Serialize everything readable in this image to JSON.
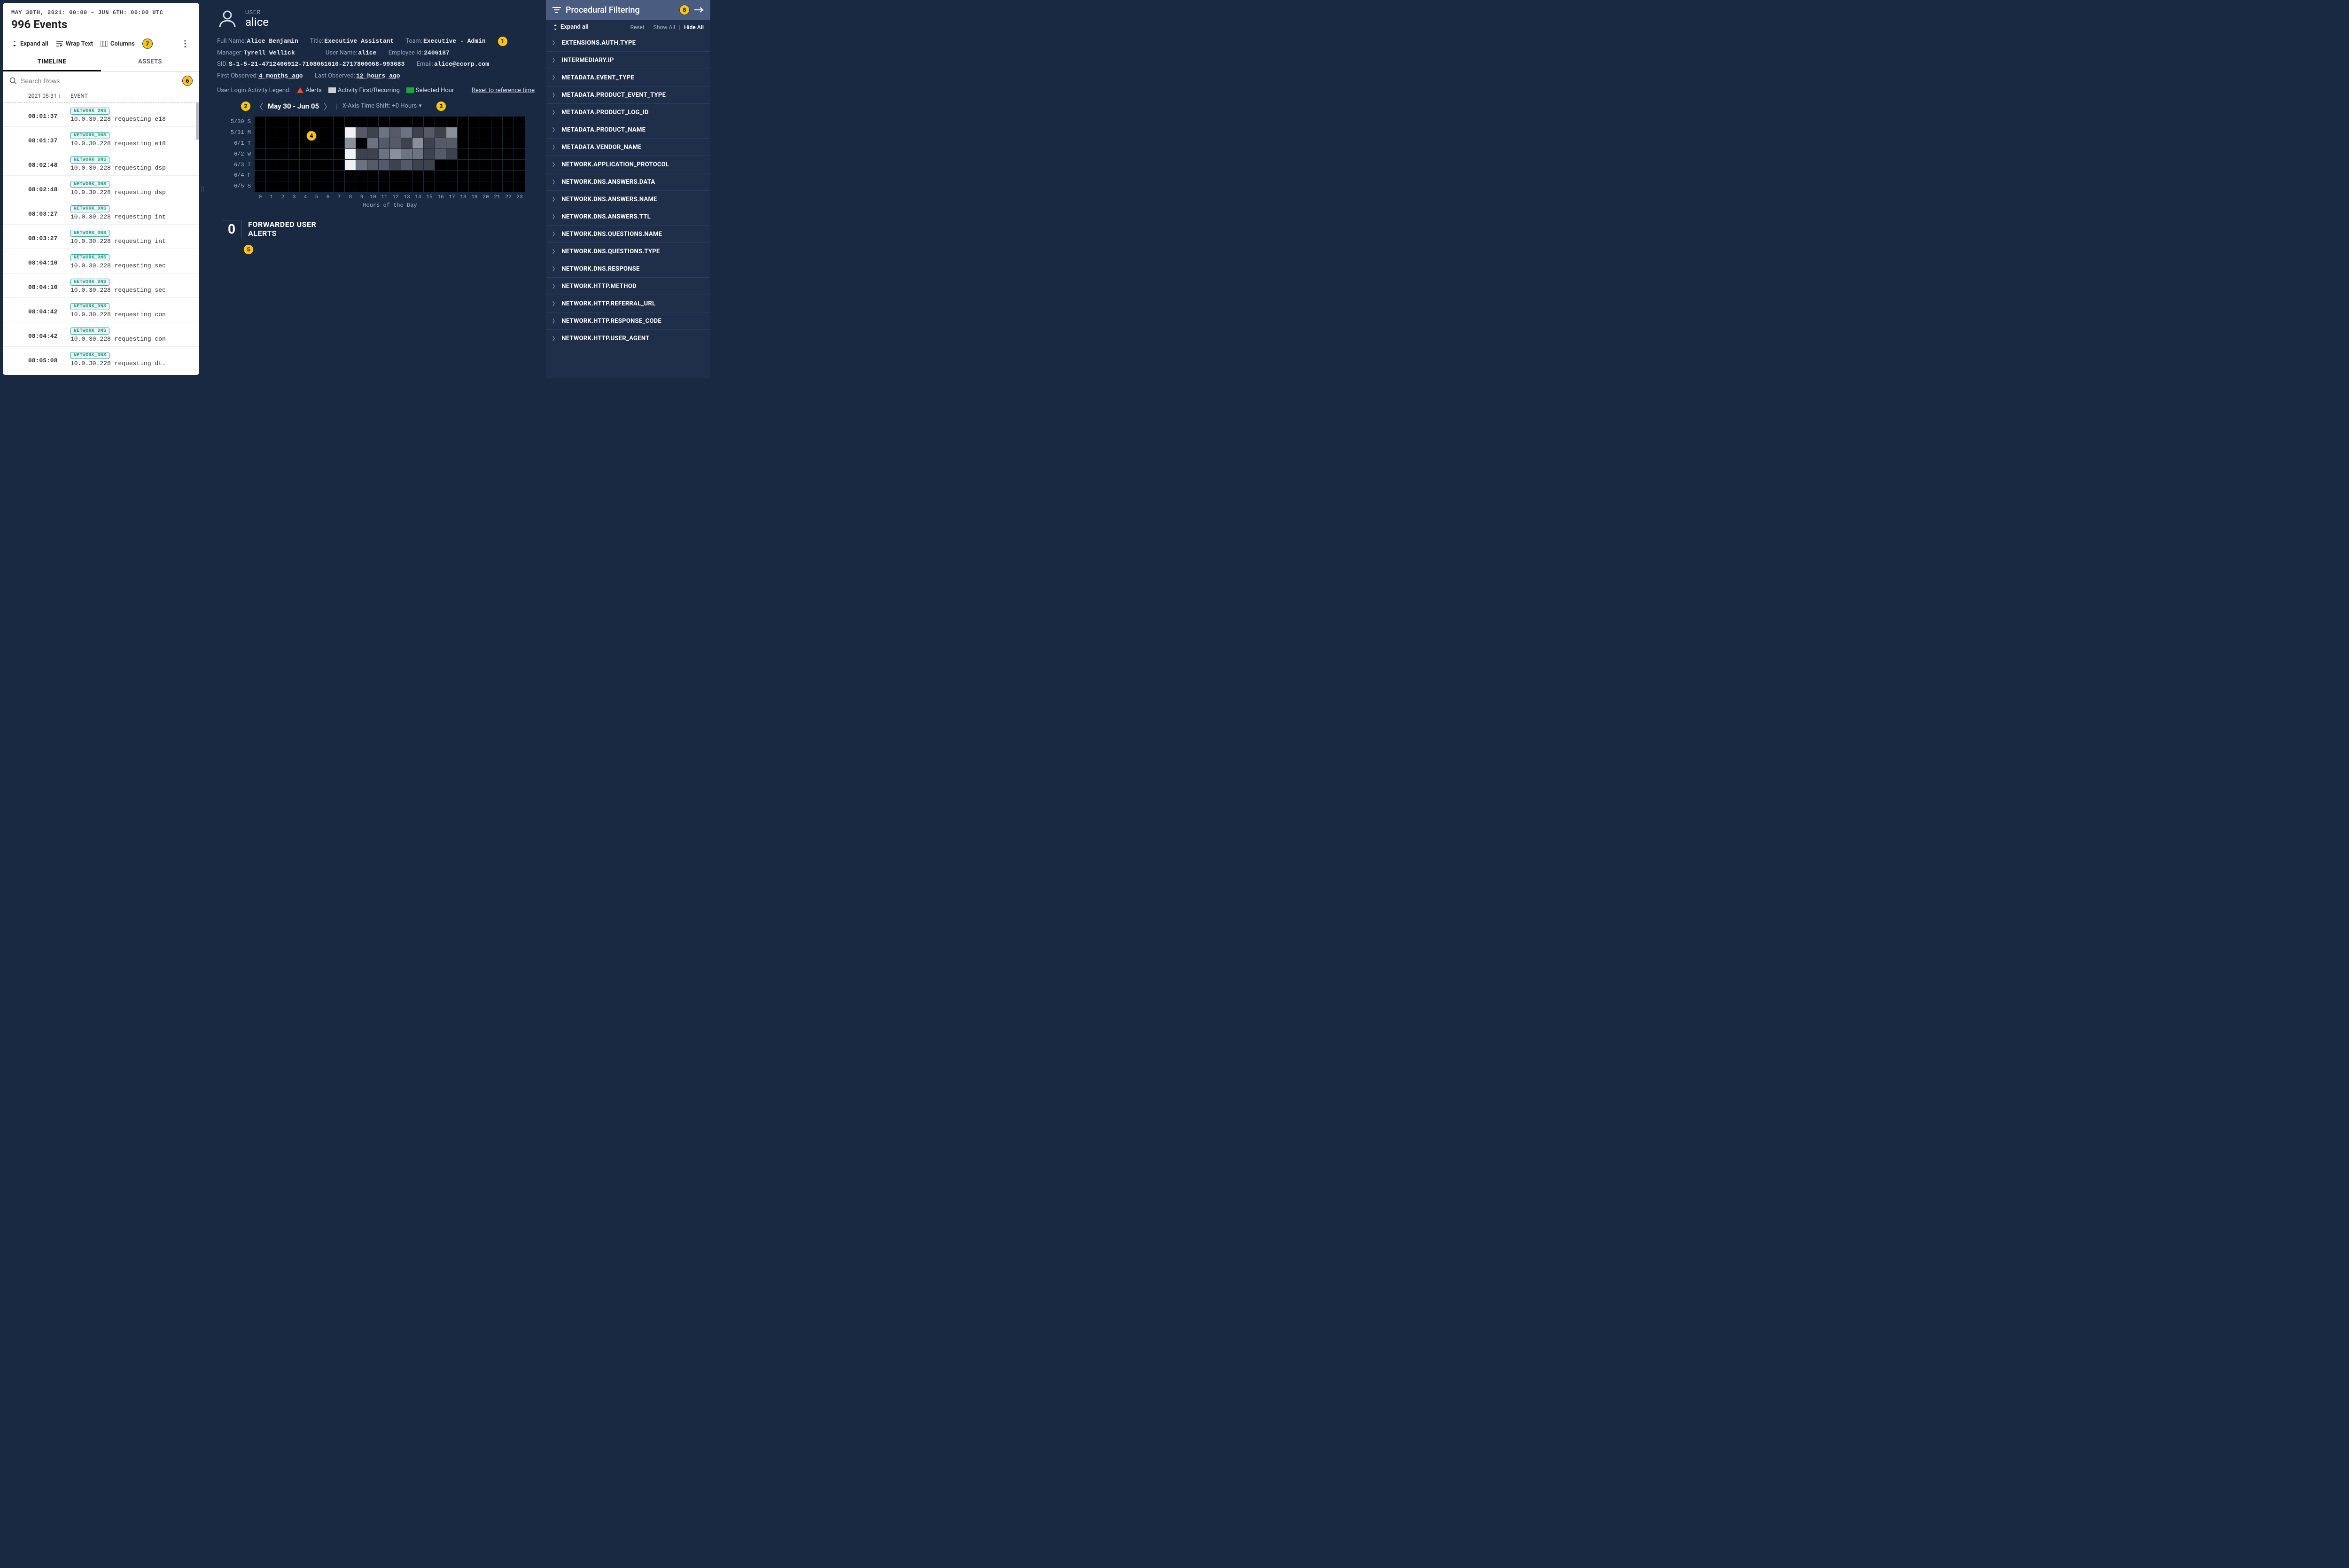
{
  "left": {
    "time_range": "MAY 30TH, 2021: 00:00 – JUN 6TH: 00:00 UTC",
    "count_label": "996 Events",
    "toolbar": {
      "expand": "Expand all",
      "wrap": "Wrap Text",
      "columns": "Columns"
    },
    "tabs": {
      "timeline": "TIMELINE",
      "assets": "ASSETS"
    },
    "search_placeholder": "Search Rows",
    "col_time": "2021-05-31 ↑",
    "col_event": "EVENT",
    "tag": "NETWORK_DNS",
    "rows": [
      {
        "t": "08:01:37",
        "d": "10.0.30.228 requesting e18"
      },
      {
        "t": "08:01:37",
        "d": "10.0.30.228 requesting e18"
      },
      {
        "t": "08:02:48",
        "d": "10.0.30.228 requesting dsp"
      },
      {
        "t": "08:02:48",
        "d": "10.0.30.228 requesting dsp"
      },
      {
        "t": "08:03:27",
        "d": "10.0.30.228 requesting int"
      },
      {
        "t": "08:03:27",
        "d": "10.0.30.228 requesting int"
      },
      {
        "t": "08:04:10",
        "d": "10.0.30.228 requesting sec"
      },
      {
        "t": "08:04:10",
        "d": "10.0.30.228 requesting sec"
      },
      {
        "t": "08:04:42",
        "d": "10.0.30.228 requesting con"
      },
      {
        "t": "08:04:42",
        "d": "10.0.30.228 requesting con"
      },
      {
        "t": "08:05:08",
        "d": "10.0.30.228 requesting dt."
      },
      {
        "t": "08:05:08",
        "d": "10.0.30.228 requesting dt."
      }
    ]
  },
  "user": {
    "section": "USER",
    "name": "alice",
    "meta": {
      "full_name_k": "Full Name:",
      "full_name_v": "Alice Benjamin",
      "title_k": "Title:",
      "title_v": "Executive Assistant",
      "team_k": "Team:",
      "team_v": "Executive - Admin",
      "manager_k": "Manager:",
      "manager_v": "Tyrell Wellick",
      "username_k": "User Name:",
      "username_v": "alice",
      "emp_k": "Employee Id:",
      "emp_v": "2406187",
      "sid_k": "SID:",
      "sid_v": "S-1-5-21-4712406912-7108061610-2717800068-993683",
      "email_k": "Email:",
      "email_v": "alice@ecorp.com",
      "first_k": "First Observed:",
      "first_v": "4 months ago",
      "last_k": "Last Observed:",
      "last_v": "12 hours ago"
    },
    "legend": {
      "label": "User Login Activity Legend:",
      "alerts": "Alerts",
      "activity": "Activity First/Recurring",
      "selected": "Selected Hour",
      "reset": "Reset to reference time"
    },
    "daterange": "May 30 - Jun 05",
    "timeshift_label": "X-Axis Time Shift:",
    "timeshift_value": "+0 Hours",
    "alerts_count": "0",
    "alerts_label": "FORWARDED USER ALERTS"
  },
  "chart_data": {
    "type": "heatmap",
    "title": "User Login Activity",
    "xlabel": "Hours of the Day",
    "ylabel": "",
    "x": [
      0,
      1,
      2,
      3,
      4,
      5,
      6,
      7,
      8,
      9,
      10,
      11,
      12,
      13,
      14,
      15,
      16,
      17,
      18,
      19,
      20,
      21,
      22,
      23
    ],
    "y_labels": [
      "5/30 S",
      "5/31 M",
      "6/1 T",
      "6/2 W",
      "6/3 T",
      "6/4 F",
      "6/5 S"
    ],
    "values": [
      [
        0,
        0,
        0,
        0,
        0,
        0,
        0,
        0,
        0,
        0,
        0,
        0,
        0,
        0,
        0,
        0,
        0,
        0,
        0,
        0,
        0,
        0,
        0,
        0
      ],
      [
        0,
        0,
        0,
        0,
        0,
        0,
        0,
        0,
        9,
        3,
        2,
        4,
        3,
        4,
        2,
        3,
        2,
        5,
        0,
        0,
        0,
        0,
        0,
        0
      ],
      [
        0,
        0,
        0,
        0,
        0,
        0,
        0,
        0,
        5,
        0,
        4,
        3,
        3,
        2,
        5,
        2,
        3,
        3,
        0,
        0,
        0,
        0,
        0,
        0
      ],
      [
        0,
        0,
        0,
        0,
        0,
        0,
        0,
        0,
        9,
        2,
        2,
        4,
        5,
        4,
        4,
        2,
        3,
        2,
        0,
        0,
        0,
        0,
        0,
        0
      ],
      [
        0,
        0,
        0,
        0,
        0,
        0,
        0,
        0,
        9,
        4,
        3,
        3,
        2,
        3,
        2,
        2,
        0,
        0,
        0,
        0,
        0,
        0,
        0,
        0
      ],
      [
        0,
        0,
        0,
        0,
        0,
        0,
        0,
        0,
        0,
        0,
        0,
        0,
        0,
        0,
        0,
        0,
        0,
        0,
        0,
        0,
        0,
        0,
        0,
        0
      ],
      [
        0,
        0,
        0,
        0,
        0,
        0,
        0,
        0,
        0,
        0,
        0,
        0,
        0,
        0,
        0,
        0,
        0,
        0,
        0,
        0,
        0,
        0,
        0,
        0
      ]
    ],
    "value_scale": "0=none, 1-3=low gray, 4-6=mid gray, 9=white (first activity)"
  },
  "right": {
    "title": "Procedural Filtering",
    "expand": "Expand all",
    "reset": "Reset",
    "show_all": "Show All",
    "hide_all": "Hide All",
    "items": [
      "EXTENSIONS.AUTH.TYPE",
      "INTERMEDIARY.IP",
      "METADATA.EVENT_TYPE",
      "METADATA.PRODUCT_EVENT_TYPE",
      "METADATA.PRODUCT_LOG_ID",
      "METADATA.PRODUCT_NAME",
      "METADATA.VENDOR_NAME",
      "NETWORK.APPLICATION_PROTOCOL",
      "NETWORK.DNS.ANSWERS.DATA",
      "NETWORK.DNS.ANSWERS.NAME",
      "NETWORK.DNS.ANSWERS.TTL",
      "NETWORK.DNS.QUESTIONS.NAME",
      "NETWORK.DNS.QUESTIONS.TYPE",
      "NETWORK.DNS.RESPONSE",
      "NETWORK.HTTP.METHOD",
      "NETWORK.HTTP.REFERRAL_URL",
      "NETWORK.HTTP.RESPONSE_CODE",
      "NETWORK.HTTP.USER_AGENT"
    ]
  },
  "annotations": [
    "1",
    "2",
    "3",
    "4",
    "5",
    "6",
    "7",
    "8"
  ]
}
